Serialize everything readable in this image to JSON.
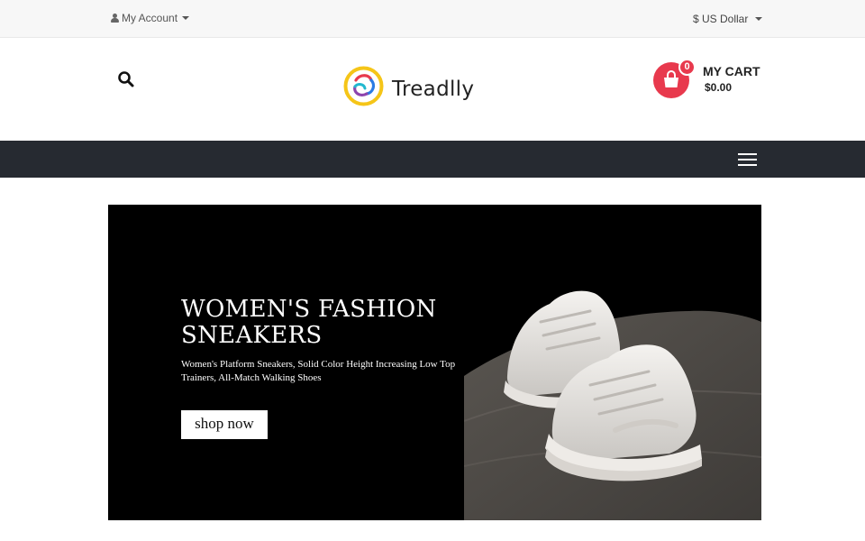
{
  "topbar": {
    "account_label": "My Account",
    "currency_label": "$ US Dollar"
  },
  "header": {
    "logo_text": "Treadlly",
    "cart_count": "0",
    "cart_label": "MY CART",
    "cart_total": "$0.00"
  },
  "banner": {
    "title": "WOMEN'S FASHION SNEAKERS",
    "description": "Women's Platform Sneakers, Solid Color Height Increasing Low Top Trainers, All-Match Walking Shoes",
    "button_label": "shop now"
  },
  "colors": {
    "accent": "#e8394d",
    "navbar": "#262a31",
    "topbar": "#f7f7f7"
  },
  "icons": [
    "user-icon",
    "caret-down-icon",
    "search-icon",
    "shopping-bag-icon",
    "hamburger-menu-icon"
  ]
}
